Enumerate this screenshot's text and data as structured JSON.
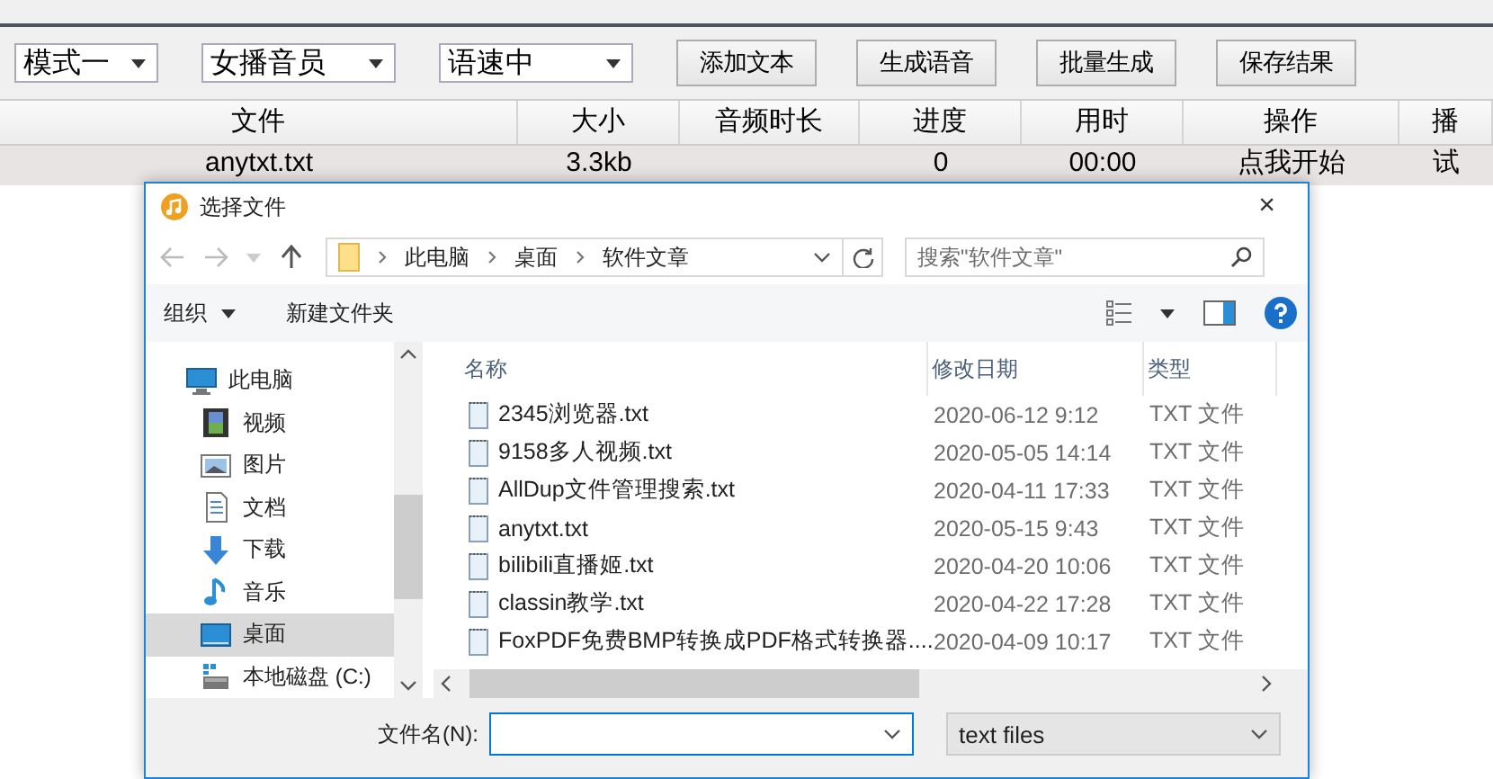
{
  "toolbar": {
    "dropdowns": [
      {
        "value": "模式一"
      },
      {
        "value": "女播音员"
      },
      {
        "value": "语速中"
      }
    ],
    "buttons": [
      "添加文本",
      "生成语音",
      "批量生成",
      "保存结果"
    ]
  },
  "table": {
    "columns": [
      "文件",
      "大小",
      "音频时长",
      "进度",
      "用时",
      "操作",
      "播"
    ],
    "rows": [
      {
        "cells": [
          "anytxt.txt",
          "3.3kb",
          null,
          "0",
          "00:00",
          "点我开始",
          "试"
        ],
        "selected": true
      }
    ]
  },
  "dialog": {
    "title": "选择文件",
    "close": "×",
    "path": [
      "此电脑",
      "桌面",
      "软件文章"
    ],
    "search": {
      "placeholder": "搜索\"软件文章\""
    },
    "commands": [
      {
        "label": "组织",
        "dropdown": true
      },
      {
        "label": "新建文件夹",
        "dropdown": false
      }
    ],
    "nav": [
      {
        "label": "此电脑",
        "kind": "computer",
        "selected": false,
        "children": [
          {
            "label": "视频",
            "kind": "video",
            "selected": false
          },
          {
            "label": "图片",
            "kind": "image",
            "selected": false
          },
          {
            "label": "文档",
            "kind": "document",
            "selected": false
          },
          {
            "label": "下载",
            "kind": "download",
            "selected": false
          },
          {
            "label": "音乐",
            "kind": "music",
            "selected": false
          },
          {
            "label": "桌面",
            "kind": "desktop",
            "selected": true
          },
          {
            "label": "本地磁盘 (C:)",
            "kind": "drive",
            "selected": false
          }
        ]
      }
    ],
    "columns": [
      "名称",
      "修改日期",
      "类型"
    ],
    "files": [
      {
        "name": "2345浏览器.txt",
        "modified": "2020-06-12 9:12",
        "type": "TXT 文件"
      },
      {
        "name": "9158多人视频.txt",
        "modified": "2020-05-05 14:14",
        "type": "TXT 文件"
      },
      {
        "name": "AllDup文件管理搜索.txt",
        "modified": "2020-04-11 17:33",
        "type": "TXT 文件"
      },
      {
        "name": "anytxt.txt",
        "modified": "2020-05-15 9:43",
        "type": "TXT 文件"
      },
      {
        "name": "bilibili直播姬.txt",
        "modified": "2020-04-20 10:06",
        "type": "TXT 文件"
      },
      {
        "name": "classin教学.txt",
        "modified": "2020-04-22 17:28",
        "type": "TXT 文件"
      },
      {
        "name": "FoxPDF免费BMP转换成PDF格式转换器....",
        "modified": "2020-04-09 10:17",
        "type": "TXT 文件"
      }
    ],
    "filename": {
      "label": "文件名(N):"
    },
    "filter": {
      "value": "text files"
    }
  }
}
